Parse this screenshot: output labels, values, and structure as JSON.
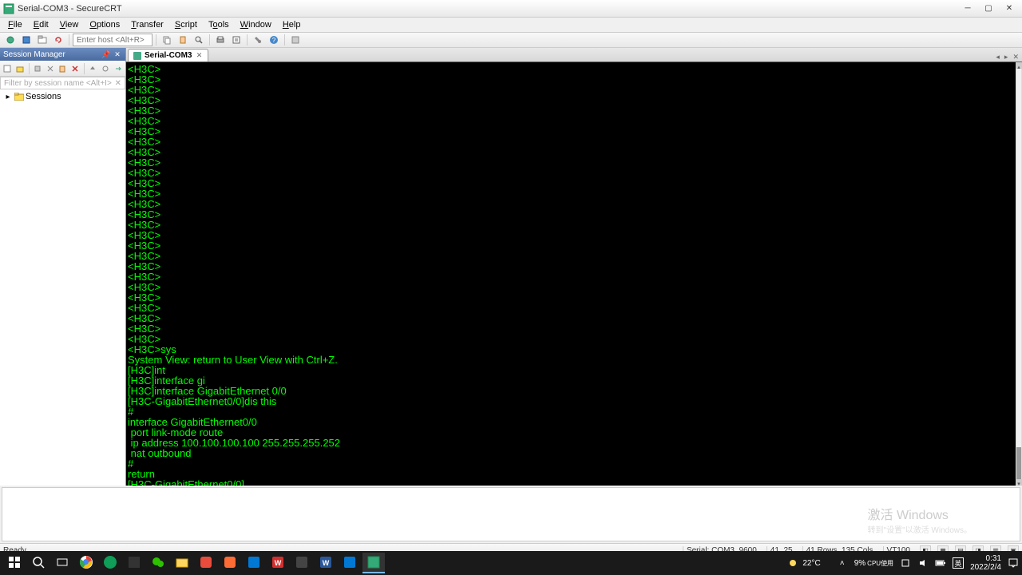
{
  "window": {
    "title": "Serial-COM3 - SecureCRT"
  },
  "menubar": {
    "items": [
      "File",
      "Edit",
      "View",
      "Options",
      "Transfer",
      "Script",
      "Tools",
      "Window",
      "Help"
    ],
    "hotkeys": [
      "F",
      "E",
      "V",
      "O",
      "T",
      "S",
      "T",
      "W",
      "H"
    ]
  },
  "toolbar": {
    "host_placeholder": "Enter host <Alt+R>"
  },
  "session_manager": {
    "title": "Session Manager",
    "filter_placeholder": "Filter by session name <Alt+I>",
    "root": "Sessions"
  },
  "tab": {
    "label": "Serial-COM3"
  },
  "terminal": {
    "lines": [
      "<H3C>",
      "<H3C>",
      "<H3C>",
      "<H3C>",
      "<H3C>",
      "<H3C>",
      "<H3C>",
      "<H3C>",
      "<H3C>",
      "<H3C>",
      "<H3C>",
      "<H3C>",
      "<H3C>",
      "<H3C>",
      "<H3C>",
      "<H3C>",
      "<H3C>",
      "<H3C>",
      "<H3C>",
      "<H3C>",
      "<H3C>",
      "<H3C>",
      "<H3C>",
      "<H3C>",
      "<H3C>",
      "<H3C>",
      "<H3C>",
      "<H3C>sys",
      "System View: return to User View with Ctrl+Z.",
      "[H3C]int",
      "[H3C]interface gi",
      "[H3C]interface GigabitEthernet 0/0",
      "[H3C-GigabitEthernet0/0]dis this",
      "#",
      "interface GigabitEthernet0/0",
      " port link-mode route",
      " ip address 100.100.100.100 255.255.255.252",
      " nat outbound",
      "#",
      "return",
      "[H3C-GigabitEthernet0/0]"
    ]
  },
  "watermark": {
    "main": "激活 Windows",
    "sub": "转到\"设置\"以激活 Windows。"
  },
  "status": {
    "left": "Ready",
    "conn": "Serial: COM3, 9600",
    "cursor": "41,  25",
    "size": "41 Rows, 135 Cols",
    "term": "VT100"
  },
  "taskbar": {
    "weather_temp": "22°C",
    "weather_desc": "",
    "cpu_label": "CPU使用",
    "cpu_value": "9%",
    "time": "0:31",
    "date": "2022/2/4"
  }
}
